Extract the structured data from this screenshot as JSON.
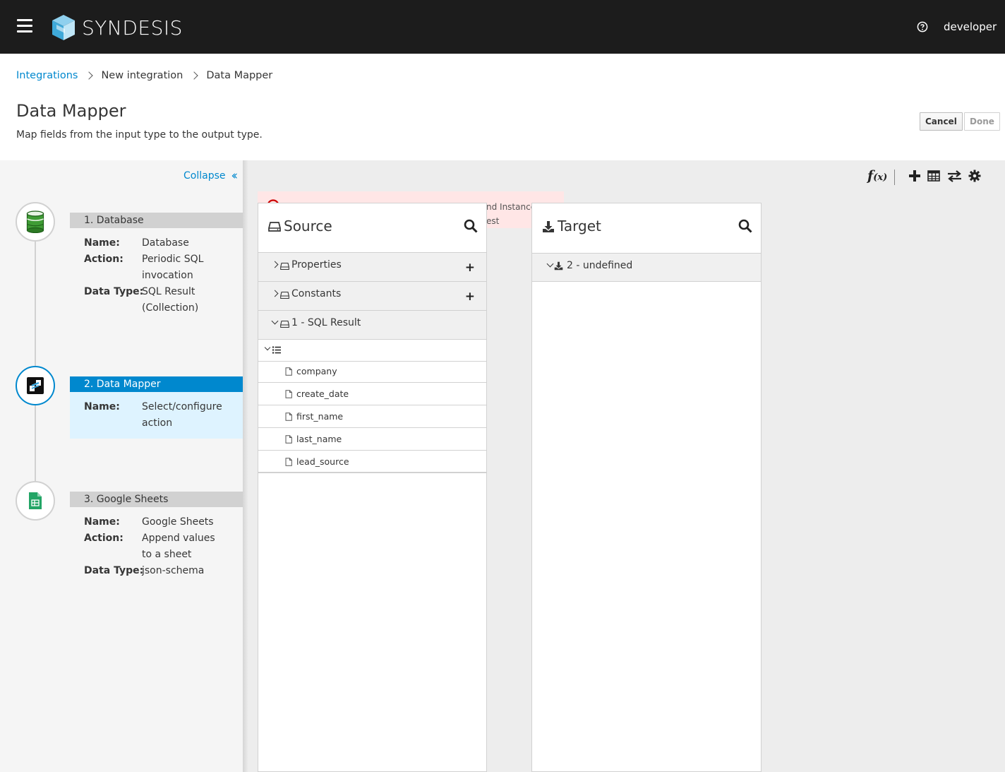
{
  "masthead": {
    "brand": "SYNDESIS",
    "user": "developer",
    "icons": {
      "menu": "hamburger-icon",
      "help": "question-circle-icon",
      "logo": "syndesis-cube-icon"
    }
  },
  "breadcrumb": {
    "items": [
      "Integrations",
      "New integration",
      "Data Mapper"
    ]
  },
  "page": {
    "title": "Data Mapper",
    "description": "Map fields from the input type to the output type."
  },
  "buttons": {
    "cancel": "Cancel",
    "done": "Done"
  },
  "sidebar": {
    "collapse_label": "Collapse",
    "steps": [
      {
        "header": "1. Database",
        "fields": [
          {
            "key": "Name:",
            "value": "Database"
          },
          {
            "key": "Action:",
            "value": "Periodic SQL invocation"
          },
          {
            "key": "Data Type:",
            "value": "SQL Result (Collection)"
          }
        ],
        "icon": "database-icon"
      },
      {
        "header": "2. Data Mapper",
        "active": true,
        "fields": [
          {
            "key": "Name:",
            "value": "Select/configure action"
          }
        ],
        "icon": "data-mapper-icon"
      },
      {
        "header": "3. Google Sheets",
        "fields": [
          {
            "key": "Name:",
            "value": "Google Sheets"
          },
          {
            "key": "Action:",
            "value": "Append values to a sheet"
          },
          {
            "key": "Data Type:",
            "value": "json-schema"
          }
        ],
        "icon": "google-sheets-icon"
      }
    ]
  },
  "toolbar": {
    "fx_label": "f",
    "fx_sub": "(x)",
    "icons": [
      "add-mapping-icon",
      "table-icon",
      "swap-icon",
      "settings-icon"
    ]
  },
  "alert": {
    "line1": "nd Instance",
    "line2": "est"
  },
  "source": {
    "title": "Source",
    "docs": [
      {
        "label": "Properties",
        "expanded": false
      },
      {
        "label": "Constants",
        "expanded": false
      },
      {
        "label": "1 - SQL Result",
        "expanded": true
      }
    ],
    "fields": [
      "company",
      "create_date",
      "first_name",
      "last_name",
      "lead_source"
    ]
  },
  "target": {
    "title": "Target",
    "docs": [
      {
        "label": "2 - undefined",
        "expanded": true
      }
    ]
  },
  "colors": {
    "masthead": "#1c1c1c",
    "accent": "#0088ce",
    "active_step_bg": "#def3ff",
    "alert_bg": "#ffe6e6",
    "db_green": "#3f9c35",
    "sheets_green": "#23a566"
  }
}
